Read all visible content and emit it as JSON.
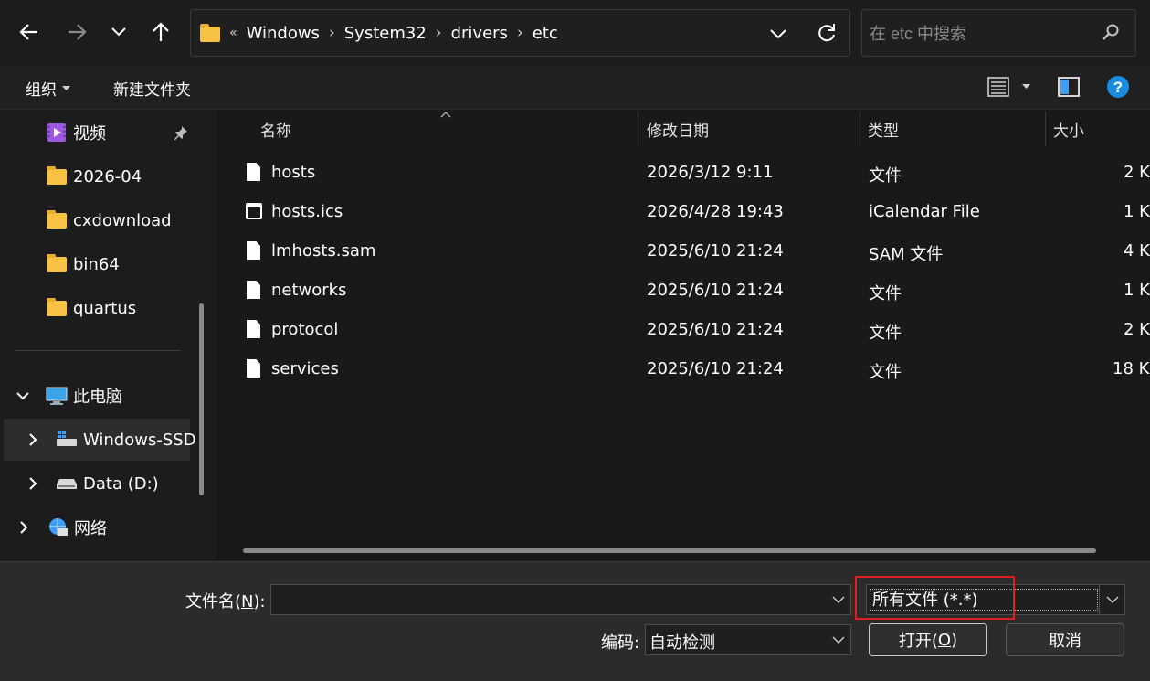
{
  "address": {
    "overflow": "«",
    "crumbs": [
      "Windows",
      "System32",
      "drivers",
      "etc"
    ],
    "separator": "›"
  },
  "search": {
    "placeholder": "在 etc 中搜索"
  },
  "toolbar": {
    "organize_label": "组织",
    "new_folder_label": "新建文件夹"
  },
  "sidebar": {
    "items": [
      {
        "label": "视频",
        "icon": "video-folder-icon"
      },
      {
        "label": "2026-04",
        "icon": "folder-icon"
      },
      {
        "label": "cxdownload",
        "icon": "folder-icon"
      },
      {
        "label": "bin64",
        "icon": "folder-icon"
      },
      {
        "label": "quartus",
        "icon": "folder-icon"
      }
    ],
    "this_pc": "此电脑",
    "drives": [
      {
        "label": "Windows-SSD",
        "icon": "windows-drive-icon"
      },
      {
        "label": "Data (D:)",
        "icon": "drive-icon"
      }
    ],
    "network": "网络"
  },
  "columns": {
    "name": "名称",
    "modified": "修改日期",
    "type": "类型",
    "size": "大小"
  },
  "files": [
    {
      "name": "hosts",
      "modified": "2026/3/12 9:11",
      "type": "文件",
      "size": "2 K",
      "icon": "file-icon"
    },
    {
      "name": "hosts.ics",
      "modified": "2026/4/28 19:43",
      "type": "iCalendar File",
      "size": "1 K",
      "icon": "calendar-file-icon"
    },
    {
      "name": "lmhosts.sam",
      "modified": "2025/6/10 21:24",
      "type": "SAM 文件",
      "size": "4 K",
      "icon": "file-icon"
    },
    {
      "name": "networks",
      "modified": "2025/6/10 21:24",
      "type": "文件",
      "size": "1 K",
      "icon": "file-icon"
    },
    {
      "name": "protocol",
      "modified": "2025/6/10 21:24",
      "type": "文件",
      "size": "2 K",
      "icon": "file-icon"
    },
    {
      "name": "services",
      "modified": "2025/6/10 21:24",
      "type": "文件",
      "size": "18 K",
      "icon": "file-icon"
    }
  ],
  "bottom": {
    "filename_label_pre": "文件名(",
    "filename_label_key": "N",
    "filename_label_post": "):",
    "filename_value": "",
    "filetype_value": "所有文件 (*.*)",
    "encoding_label": "编码:",
    "encoding_value": "自动检测",
    "open_label_pre": "打开(",
    "open_label_key": "O",
    "open_label_post": ")",
    "cancel_label": "取消"
  },
  "colors": {
    "highlight": "#e02020",
    "folder": "#f5c244",
    "help": "#1a8ce0"
  }
}
